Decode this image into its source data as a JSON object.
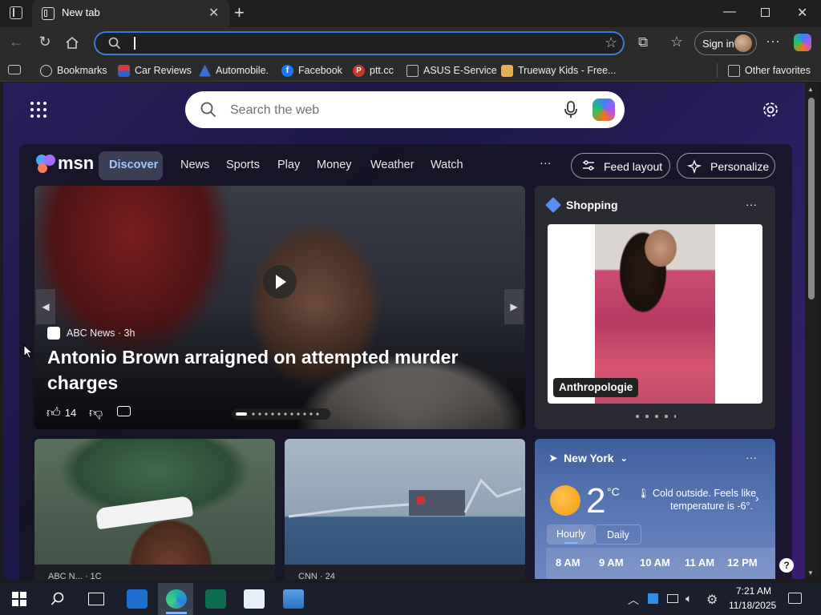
{
  "browser": {
    "tab_title": "New tab",
    "address_placeholder": "",
    "sign_in_label": "Sign in",
    "favorites": [
      {
        "label": "Bookmarks",
        "color": "#cfcfcf"
      },
      {
        "label": "Car Reviews",
        "color": "#d83b3b"
      },
      {
        "label": "Automobile.",
        "color": "#3a6fd8"
      },
      {
        "label": "Facebook",
        "color": "#1877f2"
      },
      {
        "label": "ptt.cc",
        "color": "#c0392b"
      },
      {
        "label": "ASUS E-Service",
        "color": "#bdbdbd"
      },
      {
        "label": "Trueway Kids - Free...",
        "color": "#e8b04a"
      }
    ],
    "other_favorites": "Other favorites"
  },
  "newtab": {
    "search_placeholder": "Search the web",
    "brand": "msn",
    "nav": [
      "Discover",
      "News",
      "Sports",
      "Play",
      "Money",
      "Weather",
      "Watch"
    ],
    "more": "···",
    "feed_layout": "Feed layout",
    "personalize": "Personalize",
    "hero": {
      "source": "ABC News · 3h",
      "headline": "Antonio Brown arraigned on attempted murder charges",
      "likes": "14"
    },
    "shopping": {
      "title": "Shopping",
      "brand": "Anthropologie"
    },
    "card1_source": "ABC N... · 1C",
    "card2_source": "CNN · 24",
    "weather": {
      "city": "New York",
      "temp": "2",
      "unit": "°C",
      "line1": "Cold outside. Feels like",
      "line2": "temperature is -6°.",
      "tab_hourly": "Hourly",
      "tab_daily": "Daily",
      "hours": [
        "8 AM",
        "9 AM",
        "10 AM",
        "11 AM",
        "12 PM"
      ]
    }
  },
  "taskbar": {
    "time": "7:21 AM",
    "date": "11/18/2025"
  },
  "colors": {
    "accent": "#3d7bd9",
    "discover_text": "#9fc7ff",
    "page_bg": "#1b1746"
  }
}
